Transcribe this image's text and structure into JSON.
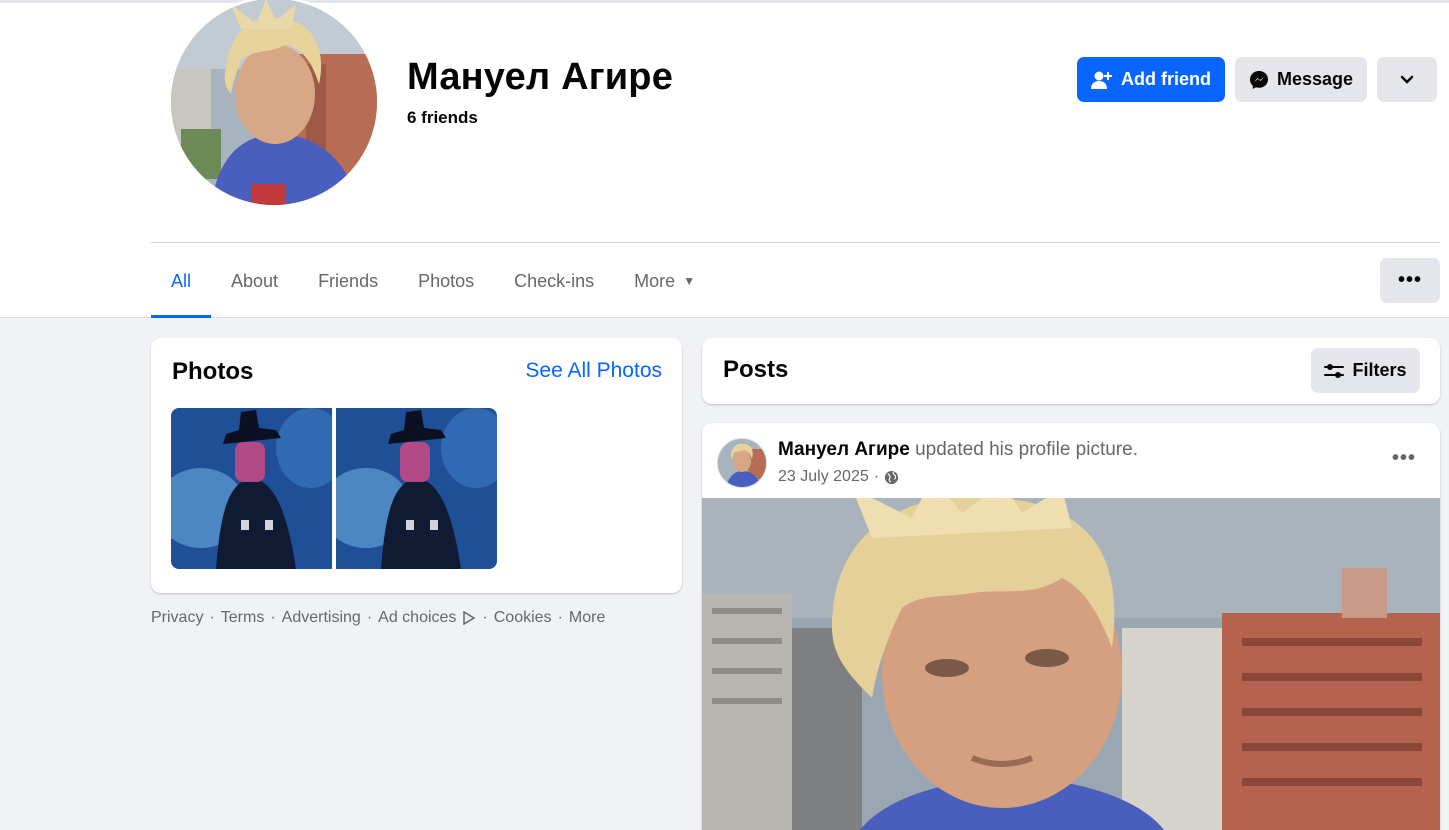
{
  "profile": {
    "name": "Мануел Агире",
    "friends_label": "6 friends"
  },
  "actions": {
    "add_friend_label": "Add friend",
    "message_label": "Message",
    "add_friend_icon": "person-plus-icon",
    "message_icon": "messenger-icon",
    "dropdown_icon": "chevron-down-icon"
  },
  "tabs": [
    {
      "label": "All",
      "active": true
    },
    {
      "label": "About",
      "active": false
    },
    {
      "label": "Friends",
      "active": false
    },
    {
      "label": "Photos",
      "active": false
    },
    {
      "label": "Check-ins",
      "active": false
    },
    {
      "label": "More",
      "active": false
    }
  ],
  "tab_more_button": "•••",
  "photos": {
    "title": "Photos",
    "see_all_label": "See All Photos"
  },
  "footer": {
    "links": [
      "Privacy",
      "Terms",
      "Advertising",
      "Ad choices",
      "Cookies",
      "More"
    ]
  },
  "posts": {
    "title": "Posts",
    "filters_label": "Filters",
    "filters_icon": "sliders-icon"
  },
  "post": {
    "author": "Мануел Агире",
    "action": " updated his profile picture.",
    "date": "23 July 2025",
    "separator": "·",
    "audience_icon": "globe-icon",
    "menu": "•••"
  },
  "colors": {
    "accent": "#0866ff",
    "secondary_button": "#e4e6eb",
    "page_background": "#f0f2f5",
    "muted_text": "#65676b"
  }
}
